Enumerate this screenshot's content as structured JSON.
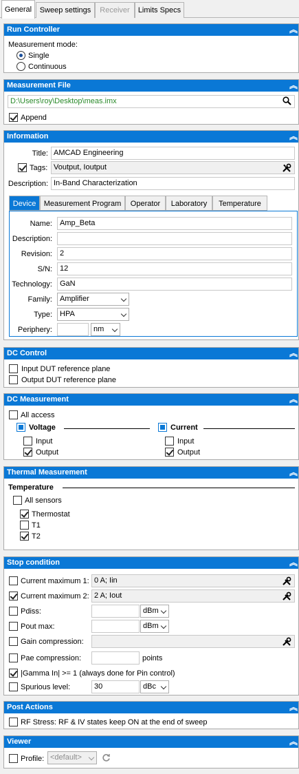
{
  "tabs": [
    "General",
    "Sweep settings",
    "Receiver",
    "Limits Specs"
  ],
  "icons": {
    "collapse": "double-chevron-up-icon",
    "search": "search-icon",
    "wrench": "wrench-screwdriver-icon",
    "refresh": "refresh-icon"
  },
  "colors": {
    "accent": "#0a78d6",
    "path_text": "#2a8a2a"
  },
  "run_controller": {
    "title": "Run Controller",
    "mode_label": "Measurement mode:",
    "single": "Single",
    "continuous": "Continuous",
    "selected": "Single"
  },
  "measurement_file": {
    "title": "Measurement File",
    "path": "D:\\Users\\roy\\Desktop\\meas.imx",
    "append_label": "Append",
    "append_checked": true
  },
  "information": {
    "title": "Information",
    "title_label": "Title:",
    "title_value": "AMCAD Engineering",
    "tags_label": "Tags:",
    "tags_value": "Voutput, Ioutput",
    "description_label": "Description:",
    "description_value": "In-Band Characterization",
    "tabs": [
      "Device",
      "Measurement Program",
      "Operator",
      "Laboratory",
      "Temperature"
    ],
    "device": {
      "name_label": "Name:",
      "name_value": "Amp_Beta",
      "description_label": "Description:",
      "description_value": "",
      "revision_label": "Revision:",
      "revision_value": "2",
      "sn_label": "S/N:",
      "sn_value": "12",
      "technology_label": "Technology:",
      "technology_value": "GaN",
      "family_label": "Family:",
      "family_value": "Amplifier",
      "type_label": "Type:",
      "type_value": "HPA",
      "periphery_label": "Periphery:",
      "periphery_value": "",
      "periphery_unit": "nm"
    }
  },
  "dc_control": {
    "title": "DC Control",
    "input_ref": "Input DUT reference plane",
    "output_ref": "Output DUT reference plane"
  },
  "dc_measurement": {
    "title": "DC Measurement",
    "all_access": "All access",
    "voltage": "Voltage",
    "current": "Current",
    "input": "Input",
    "output": "Output"
  },
  "thermal": {
    "title": "Thermal Measurement",
    "temperature": "Temperature",
    "all_sensors": "All sensors",
    "thermostat": "Thermostat",
    "t1": "T1",
    "t2": "T2"
  },
  "stop_condition": {
    "title": "Stop condition",
    "cur_max1_label": "Current maximum 1:",
    "cur_max1_value": "0 A; Iin",
    "cur_max2_label": "Current maximum 2:",
    "cur_max2_value": "2 A; Iout",
    "pdiss_label": "Pdiss:",
    "pdiss_unit": "dBm",
    "pout_label": "Pout max:",
    "pout_unit": "dBm",
    "gain_label": "Gain compression:",
    "pae_label": "Pae compression:",
    "pae_unit": "points",
    "gamma_label": "|Gamma In| >= 1 (always done for Pin control)",
    "spurious_label": "Spurious level:",
    "spurious_value": "30",
    "spurious_unit": "dBc"
  },
  "post_actions": {
    "title": "Post Actions",
    "rf_stress": "RF Stress: RF & IV states keep ON at the end of sweep"
  },
  "viewer": {
    "title": "Viewer",
    "profile_label": "Profile:",
    "profile_value": "<default>"
  }
}
